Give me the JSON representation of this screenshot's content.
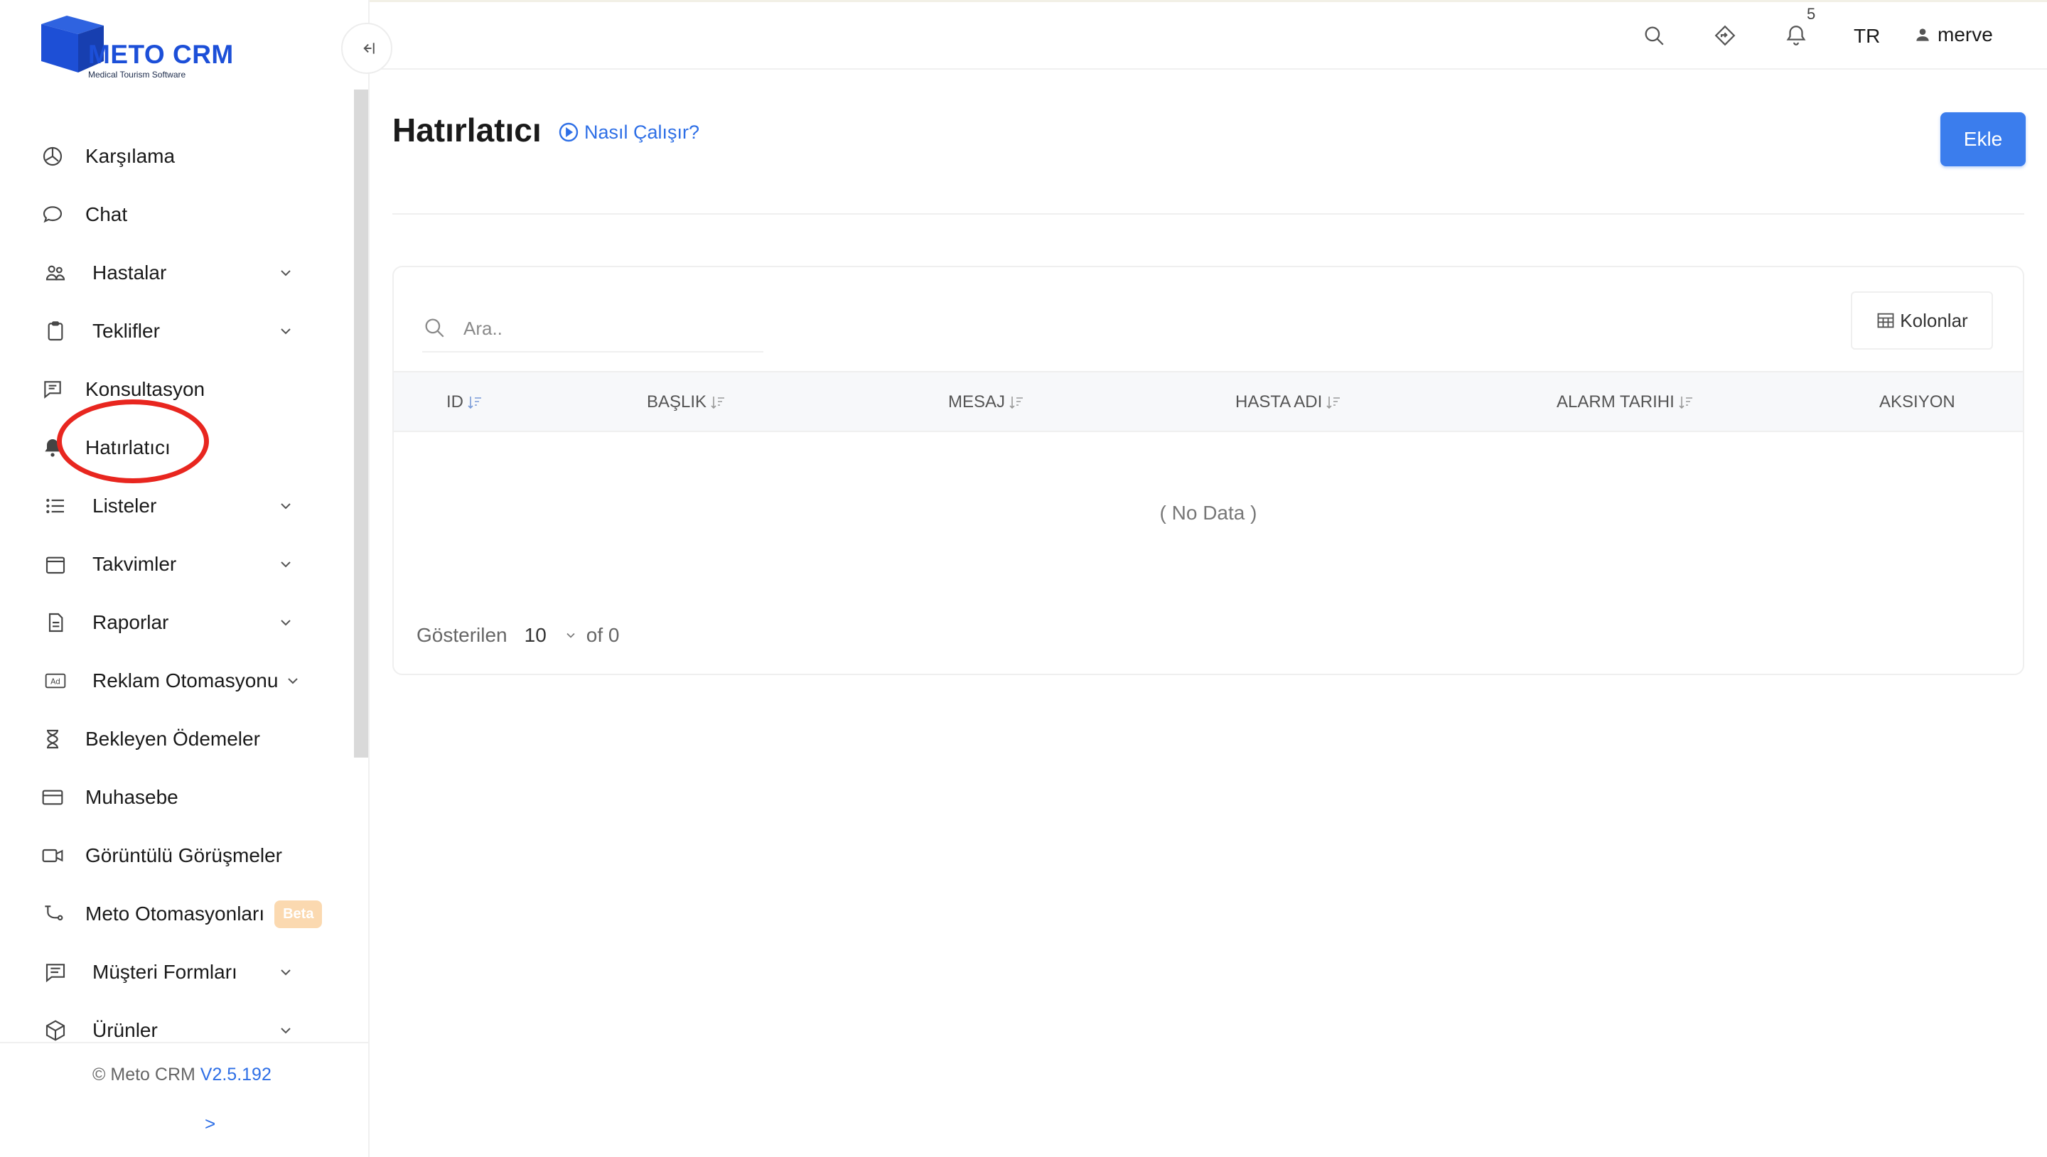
{
  "brand": {
    "name": "METO CRM",
    "tagline": "Medical Tourism Software",
    "color": "#1c4fd8"
  },
  "sidebar": {
    "items": [
      {
        "label": "Karşılama",
        "icon": "dashboard-icon",
        "has_submenu": false
      },
      {
        "label": "Chat",
        "icon": "chat-bubble-icon",
        "has_submenu": false
      },
      {
        "label": "Hastalar",
        "icon": "users-icon",
        "has_submenu": true
      },
      {
        "label": "Teklifler",
        "icon": "clipboard-icon",
        "has_submenu": true
      },
      {
        "label": "Konsultasyon",
        "icon": "message-square-icon",
        "has_submenu": false
      },
      {
        "label": "Hatırlatıcı",
        "icon": "bell-icon",
        "has_submenu": false,
        "active": true
      },
      {
        "label": "Listeler",
        "icon": "list-icon",
        "has_submenu": true
      },
      {
        "label": "Takvimler",
        "icon": "calendar-icon",
        "has_submenu": true
      },
      {
        "label": "Raporlar",
        "icon": "document-icon",
        "has_submenu": true
      },
      {
        "label": "Reklam Otomasyonu",
        "icon": "ad-icon",
        "has_submenu": true
      },
      {
        "label": "Bekleyen Ödemeler",
        "icon": "hourglass-icon",
        "has_submenu": false
      },
      {
        "label": "Muhasebe",
        "icon": "credit-card-icon",
        "has_submenu": false
      },
      {
        "label": "Görüntülü Görüşmeler",
        "icon": "video-icon",
        "has_submenu": false
      },
      {
        "label": "Meto Otomasyonları",
        "icon": "automation-icon",
        "has_submenu": false,
        "badge": "Beta"
      },
      {
        "label": "Müşteri Formları",
        "icon": "form-icon",
        "has_submenu": true
      },
      {
        "label": "Ürünler",
        "icon": "box-icon",
        "has_submenu": true
      }
    ],
    "footer": {
      "copyright": "© Meto CRM",
      "version": "V2.5.192",
      "expand": ">"
    }
  },
  "header": {
    "notification_count": "5",
    "language": "TR",
    "username": "merve"
  },
  "page": {
    "title": "Hatırlatıcı",
    "help_link": "Nasıl Çalışır?",
    "add_button": "Ekle",
    "accent": "#3b7ded"
  },
  "table": {
    "search_placeholder": "Ara..",
    "columns_button": "Kolonlar",
    "columns": [
      "ID",
      "BAŞLIK",
      "MESAJ",
      "HASTA ADI",
      "ALARM TARIHI",
      "AKSIYON"
    ],
    "empty_text": "( No Data )",
    "pagination": {
      "shown_label": "Gösterilen",
      "page_size": "10",
      "total": "of 0"
    }
  }
}
